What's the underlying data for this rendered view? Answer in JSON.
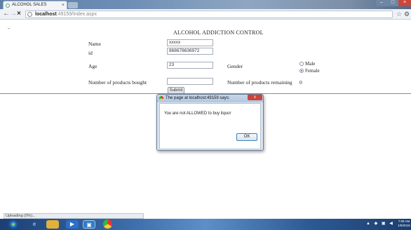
{
  "browser": {
    "tab_title": "ALCOHOL SALES",
    "url_host": "localhost",
    "url_rest": ":49159/Index.aspx"
  },
  "page": {
    "title": "ALCOHOL ADDICTION CONTROL",
    "name_label": "Name",
    "name_value": "xxxxx",
    "id_label": "id",
    "id_value": "868678636972",
    "age_label": "Age",
    "age_value": "23",
    "gender_label": "Gender",
    "gender_options": [
      "Male",
      "Female"
    ],
    "gender_selected": "Female",
    "bought_label": "Number of products bought",
    "bought_value": "",
    "remaining_label": "Number of products remaining",
    "remaining_value": "0",
    "submit_label": "Submit"
  },
  "dialog": {
    "title": "The page at localhost:49159 says:",
    "message": "You are not ALLOWED to buy liquor",
    "ok_label": "OK"
  },
  "status": {
    "text": "Uploading (0%)..."
  },
  "taskbar": {
    "time": "7:08 AM",
    "date": "1/8/2016"
  }
}
